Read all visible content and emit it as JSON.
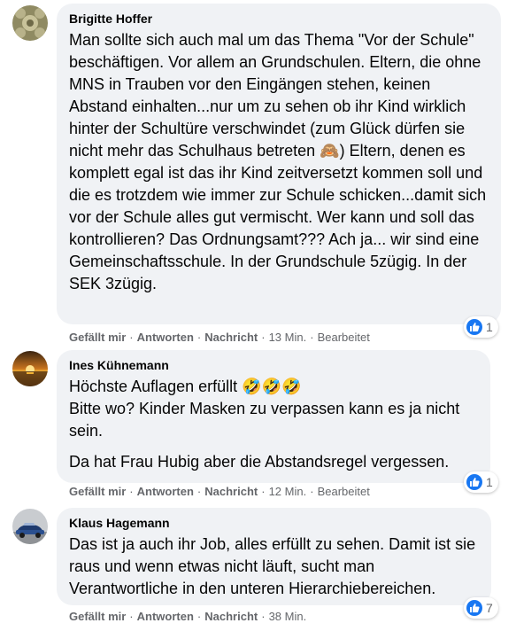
{
  "comments": [
    {
      "author": "Brigitte Hoffer",
      "paragraphs": [
        "Man sollte sich auch mal um das Thema \"Vor der Schule\" beschäftigen. Vor allem an Grundschulen. Eltern, die ohne MNS in Trauben vor den Eingängen stehen, keinen Abstand einhalten...nur um zu sehen ob ihr Kind wirklich hinter der Schultüre verschwindet (zum Glück dürfen sie nicht mehr das Schulhaus betreten 🙈) Eltern, denen es komplett egal ist das ihr Kind zeitversetzt kommen soll und die es trotzdem wie immer zur Schule schicken...damit sich vor der Schule alles gut vermischt. Wer kann und soll das kontrollieren? Das Ordnungsamt??? Ach ja... wir sind eine Gemeinschaftsschule. In der Grundschule 5zügig. In der SEK 3zügig."
      ],
      "like": "Gefällt mir",
      "reply": "Antworten",
      "message": "Nachricht",
      "time": "13 Min.",
      "edited": "Bearbeitet",
      "reaction_count": "1"
    },
    {
      "author": "Ines Kühnemann",
      "paragraphs": [
        "Höchste Auflagen erfüllt 🤣🤣🤣",
        "Bitte wo? Kinder Masken zu verpassen kann es ja nicht sein.",
        "Da hat Frau Hubig aber die Abstandsregel vergessen."
      ],
      "like": "Gefällt mir",
      "reply": "Antworten",
      "message": "Nachricht",
      "time": "12 Min.",
      "edited": "Bearbeitet",
      "reaction_count": "1"
    },
    {
      "author": "Klaus Hagemann",
      "paragraphs": [
        "Das ist ja auch ihr Job, alles erfüllt zu sehen. Damit ist sie raus und wenn etwas nicht läuft, sucht man Verantwortliche in den unteren Hierarchiebereichen."
      ],
      "like": "Gefällt mir",
      "reply": "Antworten",
      "message": "Nachricht",
      "time": "38 Min.",
      "reaction_count": "7"
    }
  ],
  "colors": {
    "bubble": "#f0f2f5",
    "like_blue": "#1877f2",
    "meta_text": "#65676b"
  }
}
